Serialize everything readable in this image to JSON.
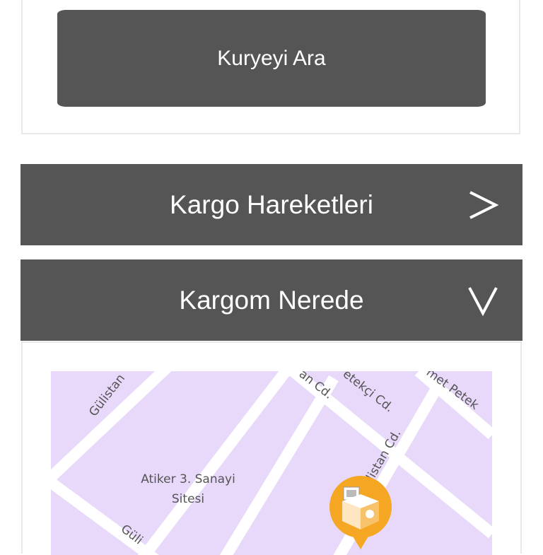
{
  "call_section": {
    "button_label": "Kuryeyi Ara"
  },
  "accordions": {
    "cargo_movements": {
      "label": "Kargo Hareketleri",
      "arrow": ">"
    },
    "where_is_my_cargo": {
      "label": "Kargom Nerede",
      "arrow": "V"
    }
  },
  "map": {
    "background_color": "#e8d9fb",
    "road_color": "#ffffff",
    "marker_color": "#f5a623",
    "labels": {
      "gulistan_1": "Gülistan",
      "an_cd": "an Cd.",
      "petekci_cd": "etekçi Cd.",
      "met_petek": "met Petek",
      "gulistan_cd": "ülistan Cd.",
      "atiker_line1": "Atiker 3. Sanayi",
      "atiker_line2": "Sitesi",
      "gulistan_2": "Güli"
    },
    "marker_icon": "cargo-box-icon"
  }
}
